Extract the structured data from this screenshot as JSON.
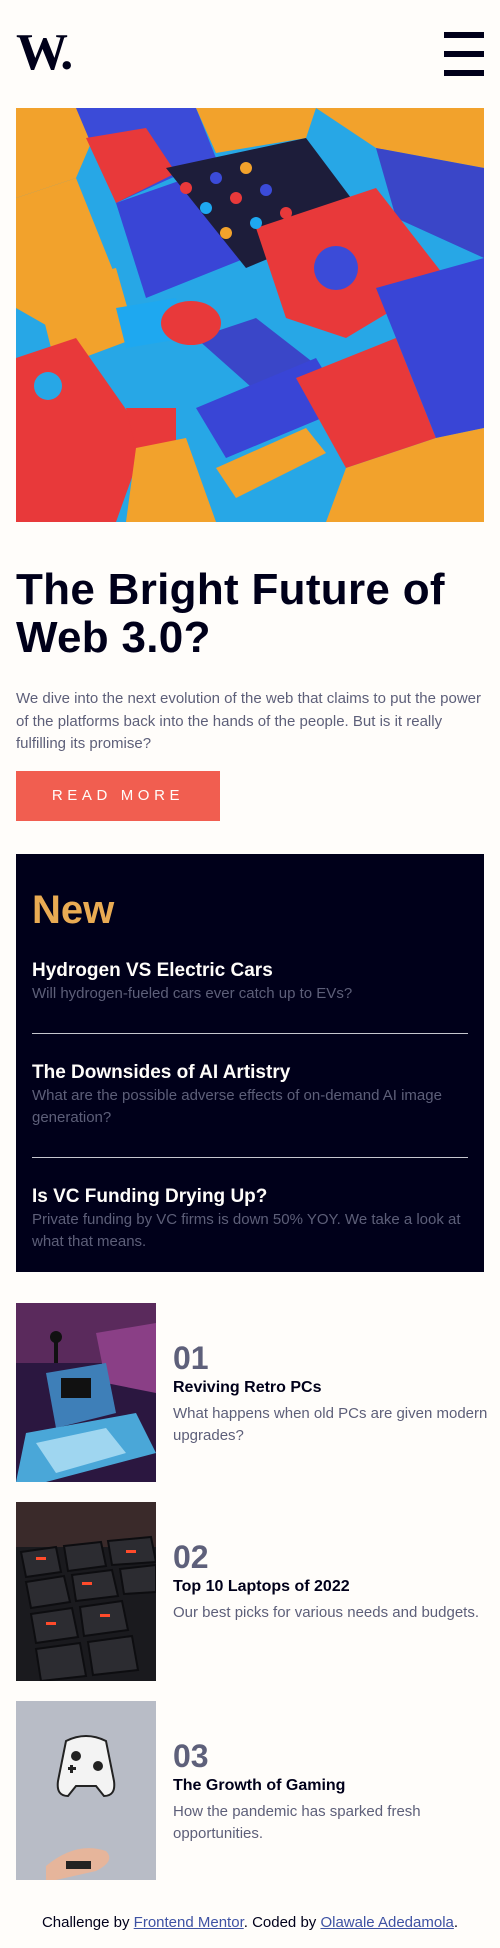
{
  "header": {
    "logo": "W.",
    "menu_icon": "hamburger-icon"
  },
  "hero": {
    "image_alt": "colorful 3D blocks illustration",
    "title": "The Bright Future of Web 3.0?",
    "description": "We dive into the next evolution of the web that claims to put the power of the platforms back into the hands of the people. But is it really fulfilling its promise?",
    "button_label": "READ MORE"
  },
  "new": {
    "heading": "New",
    "items": [
      {
        "title": "Hydrogen VS Electric Cars",
        "description": "Will hydrogen-fueled cars ever catch up to EVs?"
      },
      {
        "title": "The Downsides of AI Artistry",
        "description": "What are the possible adverse effects of on-demand AI image generation?"
      },
      {
        "title": "Is VC Funding Drying Up?",
        "description": "Private funding by VC firms is down 50% YOY. We take a look at what that means."
      }
    ]
  },
  "articles": [
    {
      "number": "01",
      "title": "Reviving Retro PCs",
      "description": "What happens when old PCs are given modern upgrades?"
    },
    {
      "number": "02",
      "title": "Top 10 Laptops of 2022",
      "description": "Our best picks for various needs and budgets."
    },
    {
      "number": "03",
      "title": "The Growth of Gaming",
      "description": "How the pandemic has sparked fresh opportunities."
    }
  ],
  "footer": {
    "prefix": "Challenge by ",
    "link1": "Frontend Mentor",
    "middle": ". Coded by ",
    "link2": "Olawale Adedamola",
    "suffix": "."
  },
  "colors": {
    "background": "#fffdfa",
    "dark": "#00001a",
    "accent_red": "#f15e50",
    "accent_orange": "#e9ab53",
    "muted": "#5d5f79"
  }
}
